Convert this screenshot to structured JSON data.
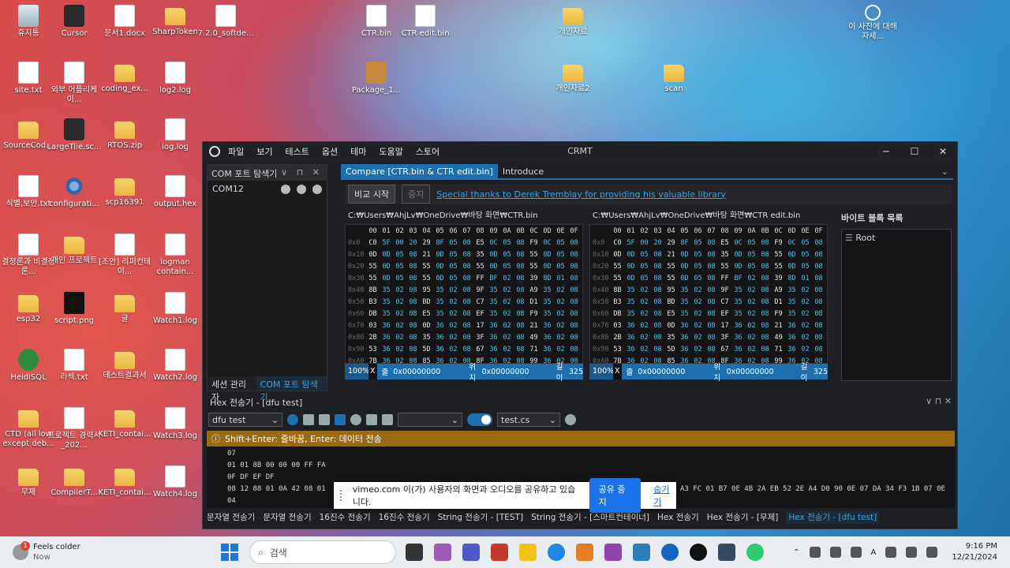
{
  "desktop_icons": [
    {
      "label": "휴지통",
      "type": "bin"
    },
    {
      "label": "Cursor",
      "type": "app"
    },
    {
      "label": "문서1.docx",
      "type": "doc"
    },
    {
      "label": "SharpToken",
      "type": "folder"
    },
    {
      "label": "7.2.0_softde...",
      "type": "doc"
    },
    {
      "label": "CTR.bin",
      "type": "doc"
    },
    {
      "label": "CTR edit.bin",
      "type": "doc"
    },
    {
      "label": "개인자료",
      "type": "folder"
    },
    {
      "label": "이 사진에 대해 자세...",
      "type": "circle"
    },
    {
      "label": "site.txt",
      "type": "doc"
    },
    {
      "label": "외부 어플리케이...",
      "type": "doc"
    },
    {
      "label": "coding_ex...",
      "type": "folder"
    },
    {
      "label": "log2.log",
      "type": "doc"
    },
    {
      "label": "Package_1...",
      "type": "pkg"
    },
    {
      "label": "개인자료2",
      "type": "folder"
    },
    {
      "label": "scan",
      "type": "folder"
    },
    {
      "label": "SourceCod...",
      "type": "folder"
    },
    {
      "label": "LargeTile.sc...",
      "type": "app"
    },
    {
      "label": "RTOS.zip",
      "type": "folder"
    },
    {
      "label": "log.log",
      "type": "doc"
    },
    {
      "label": "식별,보안.txt",
      "type": "doc"
    },
    {
      "label": "configurati...",
      "type": "gear"
    },
    {
      "label": "scp16391",
      "type": "folder"
    },
    {
      "label": "output.hex",
      "type": "doc"
    },
    {
      "label": "결정론과 비결정론...",
      "type": "doc"
    },
    {
      "label": "개인 프로젝트",
      "type": "folder"
    },
    {
      "label": "[조안] 리퍼컨테이...",
      "type": "doc"
    },
    {
      "label": "logman contain...",
      "type": "doc"
    },
    {
      "label": "esp32",
      "type": "folder"
    },
    {
      "label": "script.png",
      "type": "dark"
    },
    {
      "label": "글",
      "type": "folder"
    },
    {
      "label": "Watch1.log",
      "type": "doc"
    },
    {
      "label": "HeidiSQL",
      "type": "green"
    },
    {
      "label": "라섹.txt",
      "type": "doc"
    },
    {
      "label": "테스트결과서",
      "type": "folder"
    },
    {
      "label": "Watch2.log",
      "type": "doc"
    },
    {
      "label": "CTD (all low except deb...",
      "type": "folder"
    },
    {
      "label": "프로젝트 경력서_202...",
      "type": "doc"
    },
    {
      "label": "KETI_contai...",
      "type": "folder"
    },
    {
      "label": "Watch3.log",
      "type": "doc"
    },
    {
      "label": "무제",
      "type": "folder"
    },
    {
      "label": "CompilerT...",
      "type": "folder"
    },
    {
      "label": "KETI_contai...",
      "type": "folder"
    },
    {
      "label": "Watch4.log",
      "type": "doc"
    }
  ],
  "window": {
    "title": "CRMT",
    "menu": [
      "파일",
      "보기",
      "테스트",
      "옵션",
      "테마",
      "도움말",
      "스토어"
    ],
    "controls": {
      "minimize": "─",
      "maximize": "☐",
      "close": "✕"
    }
  },
  "com_explorer": {
    "title": "COM 포트 탐색기",
    "controls": "∨ ⊓ ✕",
    "items": [
      "COM12"
    ],
    "tabs": [
      "세션 관리자",
      "COM 포트 탐색기"
    ]
  },
  "doc_tabs": [
    "Compare [CTR.bin & CTR edit.bin]",
    "Introduce"
  ],
  "compare": {
    "start_label": "비교 시작",
    "stop_label": "중지",
    "thanks_link": "Special thanks to Derek Tremblay for providing his valuable library",
    "header": [
      "00",
      "01",
      "02",
      "03",
      "04",
      "05",
      "06",
      "07",
      "08",
      "09",
      "0A",
      "0B",
      "0C",
      "0D",
      "0E",
      "0F"
    ],
    "offsets": [
      "0x0",
      "0x10",
      "0x20",
      "0x30",
      "0x40",
      "0x50",
      "0x60",
      "0x70",
      "0x80",
      "0x90",
      "0xA0"
    ],
    "left_path": "C:₩Users₩AhjLv₩OneDrive₩바탕 화면₩CTR.bin",
    "right_path": "C:₩Users₩AhjLv₩OneDrive₩바탕 화면₩CTR edit.bin",
    "rows": [
      [
        "C0",
        "5F",
        "00",
        "20",
        "29",
        "8F",
        "05",
        "08",
        "E5",
        "0C",
        "05",
        "08",
        "F9",
        "0C",
        "05",
        "08"
      ],
      [
        "0D",
        "0D",
        "05",
        "08",
        "21",
        "0D",
        "05",
        "08",
        "35",
        "0D",
        "05",
        "08",
        "55",
        "0D",
        "05",
        "08"
      ],
      [
        "55",
        "0D",
        "05",
        "08",
        "55",
        "0D",
        "05",
        "08",
        "55",
        "0D",
        "05",
        "08",
        "55",
        "0D",
        "05",
        "08"
      ],
      [
        "55",
        "0D",
        "05",
        "08",
        "55",
        "0D",
        "05",
        "08",
        "FF",
        "BF",
        "02",
        "08",
        "39",
        "8D",
        "01",
        "08"
      ],
      [
        "8B",
        "35",
        "02",
        "08",
        "95",
        "35",
        "02",
        "08",
        "9F",
        "35",
        "02",
        "08",
        "A9",
        "35",
        "02",
        "08"
      ],
      [
        "B3",
        "35",
        "02",
        "08",
        "BD",
        "35",
        "02",
        "08",
        "C7",
        "35",
        "02",
        "08",
        "D1",
        "35",
        "02",
        "08"
      ],
      [
        "DB",
        "35",
        "02",
        "08",
        "E5",
        "35",
        "02",
        "08",
        "EF",
        "35",
        "02",
        "08",
        "F9",
        "35",
        "02",
        "08"
      ],
      [
        "03",
        "36",
        "02",
        "08",
        "0D",
        "36",
        "02",
        "08",
        "17",
        "36",
        "02",
        "08",
        "21",
        "36",
        "02",
        "08"
      ],
      [
        "2B",
        "36",
        "02",
        "08",
        "35",
        "36",
        "02",
        "08",
        "3F",
        "36",
        "02",
        "08",
        "49",
        "36",
        "02",
        "08"
      ],
      [
        "53",
        "36",
        "02",
        "08",
        "5D",
        "36",
        "02",
        "08",
        "67",
        "36",
        "02",
        "08",
        "71",
        "36",
        "02",
        "08"
      ],
      [
        "7B",
        "36",
        "02",
        "08",
        "85",
        "36",
        "02",
        "08",
        "8F",
        "36",
        "02",
        "08",
        "99",
        "36",
        "02",
        "08"
      ]
    ],
    "left_status": {
      "zoom": "100%",
      "x": "X",
      "line_label": "줄",
      "line": "0x00000000",
      "pos_label": "위치",
      "pos": "0x00000000",
      "len_label": "길이",
      "len": "325"
    },
    "right_status": {
      "zoom": "100%",
      "x": "X",
      "line_label": "줄",
      "line": "0x00000000",
      "pos_label": "위치",
      "pos": "0x00000000",
      "len_label": "길이",
      "len": "325"
    }
  },
  "byte_blocks": {
    "title": "바이트 블록 목록",
    "root": "Root"
  },
  "hex_sender": {
    "title": "Hex 전송기 - [dfu test]",
    "controls": "∨ ⊓ ✕",
    "script_select": "dfu test",
    "file_select": "test.cs",
    "hint": "Shift+Enter: 줄바꿈, Enter: 데이터 전송",
    "lines": [
      "07",
      "01 01 8B 00 00 00 FF FA",
      "0F DF EF DF",
      "08 12 88 01 0A 42 08 01",
      "04"
    ],
    "overflow_text": "A3 FC 01 B7 0E 4B 2A EB 52 2E A4 D0 90 0E 07 DA 34 F3 1B 07 0E"
  },
  "share_bar": {
    "text": "vimeo.com 이(가) 사용자의 화면과 오디오를 공유하고 있습니다.",
    "stop": "공유 중지",
    "hide": "숨기기"
  },
  "bottom_tabs": [
    "문자열 전송기",
    "문자열 전송기",
    "16진수 전송기",
    "16진수 전송기",
    "String 전송기 - [TEST]",
    "String 전송기 - [스마트컨테이너]",
    "Hex 전송기",
    "Hex 전송기 - [무제]",
    "Hex 전송기 - [dfu test]"
  ],
  "taskbar": {
    "weather_title": "Feels colder",
    "weather_sub": "Now",
    "weather_badge": "1",
    "search_placeholder": "검색",
    "time": "9:16 PM",
    "date": "12/21/2024",
    "lang": "A",
    "accent": "#1e78d4"
  }
}
